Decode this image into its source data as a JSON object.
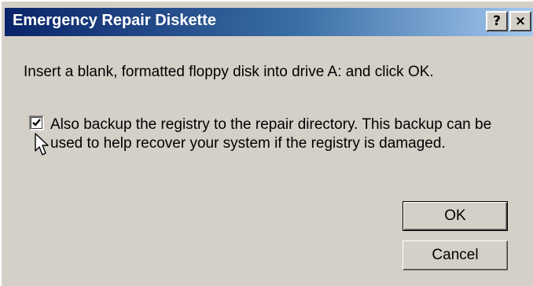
{
  "window": {
    "title": "Emergency Repair Diskette",
    "help_label": "?",
    "close_label": "×"
  },
  "dialog": {
    "message": "Insert a blank, formatted floppy disk into drive A: and click OK.",
    "checkbox": {
      "checked": true,
      "label": "Also backup the registry to the repair directory. This backup can be used to help recover your system if the registry is damaged."
    },
    "ok_label": "OK",
    "cancel_label": "Cancel"
  },
  "icons": {
    "cursor": "arrow-cursor-icon",
    "check": "checkmark-icon"
  },
  "colors": {
    "title_gradient_start": "#0a246a",
    "title_gradient_end": "#a6caf0",
    "face": "#d4d0c8"
  }
}
